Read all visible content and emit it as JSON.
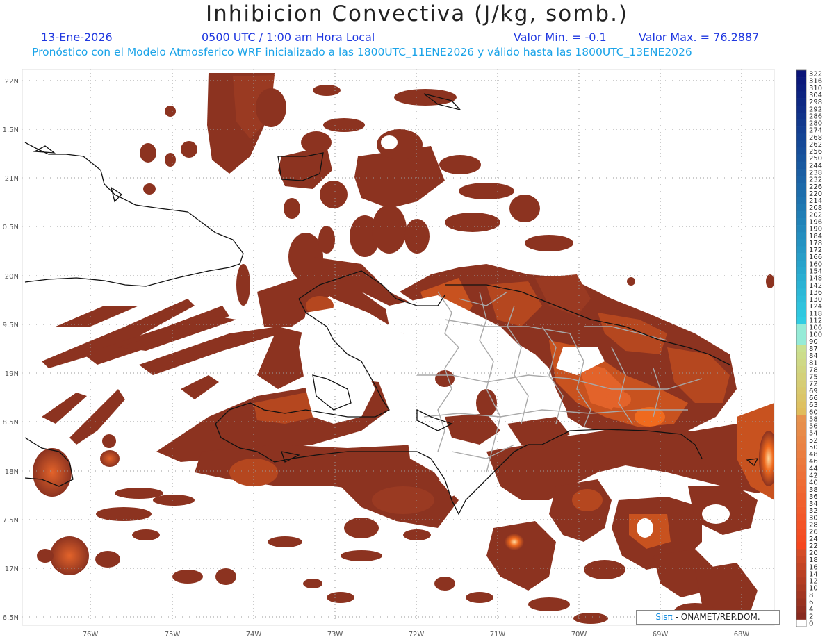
{
  "header": {
    "title": "Inhibicion Convectiva (J/kg, somb.)",
    "date": "13-Ene-2026",
    "time": "0500 UTC / 1:00 am Hora Local",
    "min_label": "Valor Min. = -0.1",
    "max_label": "Valor Max. = 76.2887",
    "forecast_line": "Pronóstico con el Modelo Atmosferico WRF inicializado a las 1800UTC_11ENE2026 y válido hasta las  1800UTC_13ENE2026"
  },
  "axes": {
    "lon_labels": [
      "76W",
      "75W",
      "74W",
      "73W",
      "72W",
      "71W",
      "70W",
      "69W",
      "68W"
    ],
    "lat_labels": [
      "22N",
      "1.5N",
      "21N",
      "0.5N",
      "20N",
      "9.5N",
      "19N",
      "8.5N",
      "18N",
      "7.5N",
      "17N",
      "6.5N"
    ]
  },
  "colorbar": {
    "labels": [
      "322",
      "316",
      "310",
      "304",
      "298",
      "292",
      "286",
      "280",
      "274",
      "268",
      "262",
      "256",
      "250",
      "244",
      "238",
      "232",
      "226",
      "220",
      "214",
      "208",
      "202",
      "196",
      "190",
      "184",
      "178",
      "172",
      "166",
      "160",
      "154",
      "148",
      "142",
      "136",
      "130",
      "124",
      "118",
      "112",
      "106",
      "100",
      "90",
      "87",
      "84",
      "81",
      "78",
      "75",
      "72",
      "69",
      "66",
      "63",
      "60",
      "58",
      "56",
      "54",
      "52",
      "50",
      "48",
      "46",
      "44",
      "42",
      "40",
      "38",
      "36",
      "34",
      "32",
      "30",
      "28",
      "26",
      "24",
      "22",
      "20",
      "18",
      "16",
      "14",
      "12",
      "10",
      "8",
      "6",
      "4",
      "2",
      "0"
    ]
  },
  "credit": {
    "brand": "Sisπ",
    "text": "- ONAMET/REP.DOM."
  },
  "colors": {
    "field_dark": "#8c3320",
    "field_mid": "#b5471f",
    "field_bright": "#ef6a1e",
    "coast": "#111111",
    "provinces": "#a8a8a8"
  }
}
